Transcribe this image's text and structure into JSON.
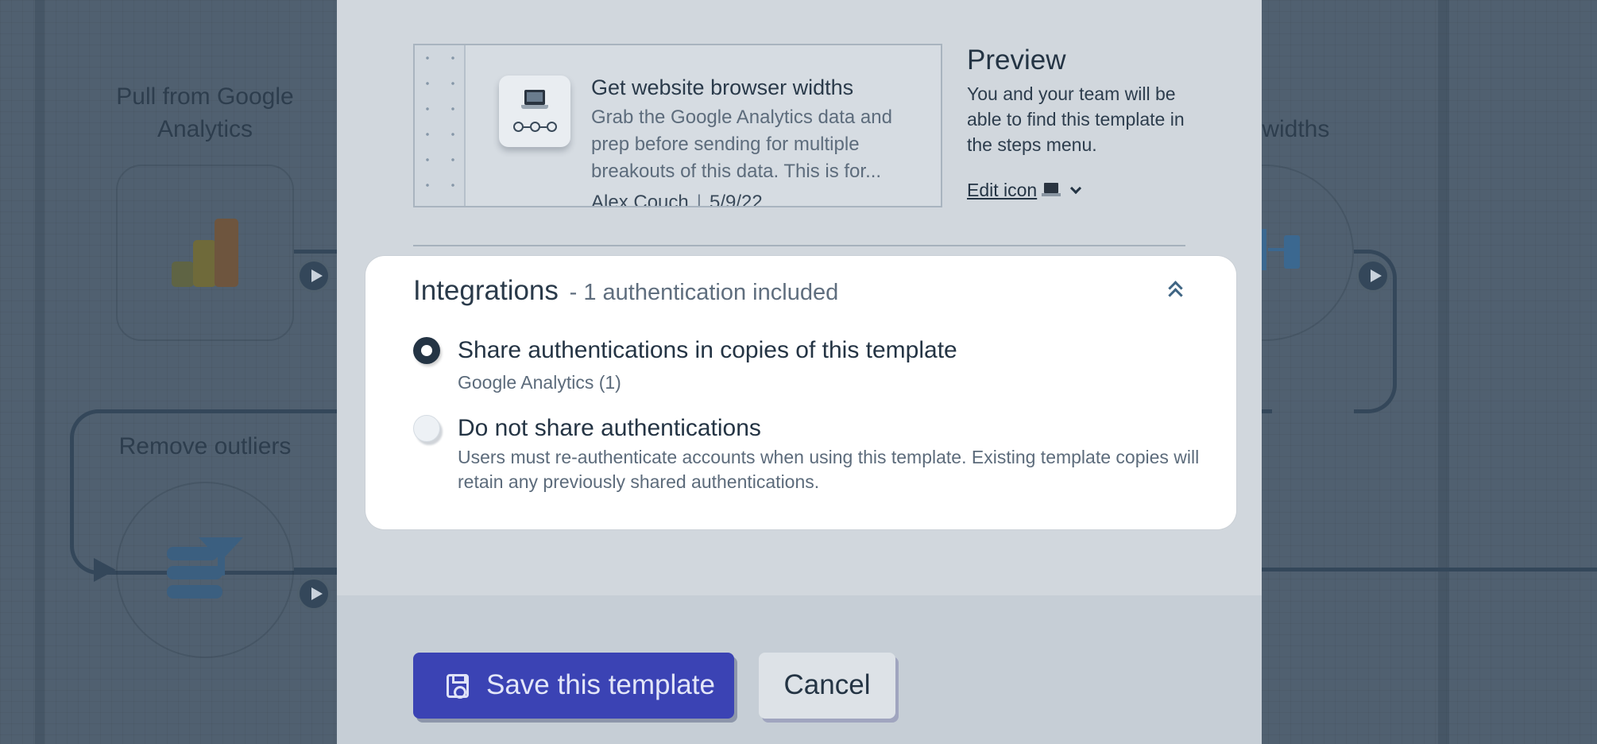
{
  "background": {
    "steps": {
      "pull_title": "Pull from Google Analytics",
      "outliers_title": "Remove outliers",
      "right_title_fragment": "r widths"
    }
  },
  "preview_card": {
    "title": "Get website browser widths",
    "description": "Grab the Google Analytics data and prep before sending for multiple breakouts of this data. This is for...",
    "author": "Alex Couch",
    "separator": "|",
    "date": "5/9/22"
  },
  "preview_info": {
    "heading": "Preview",
    "text": "You and your team will be able to find this template in the steps menu.",
    "edit_icon_label": "Edit icon"
  },
  "integrations": {
    "title": "Integrations",
    "count_text": "- 1 authentication included",
    "options": [
      {
        "label": "Share authentications in copies of this template",
        "sub": "Google Analytics (1)",
        "selected": true
      },
      {
        "label": "Do not share authentications",
        "sub": "Users must re-authenticate accounts when using this template. Existing template copies will retain any previously shared authentications.",
        "selected": false
      }
    ]
  },
  "footer": {
    "save_label": "Save this template",
    "cancel_label": "Cancel"
  },
  "colors": {
    "primary": "#3b43b4",
    "overlay": "#506070",
    "modal_bg": "#d1d7dd",
    "text_dark": "#243444"
  },
  "icons": [
    "laptop-icon",
    "chain-icon",
    "chevron-down-icon",
    "double-chevron-up-icon",
    "floppy-disk-icon",
    "play-icon",
    "google-analytics-icon",
    "filter-icon"
  ]
}
